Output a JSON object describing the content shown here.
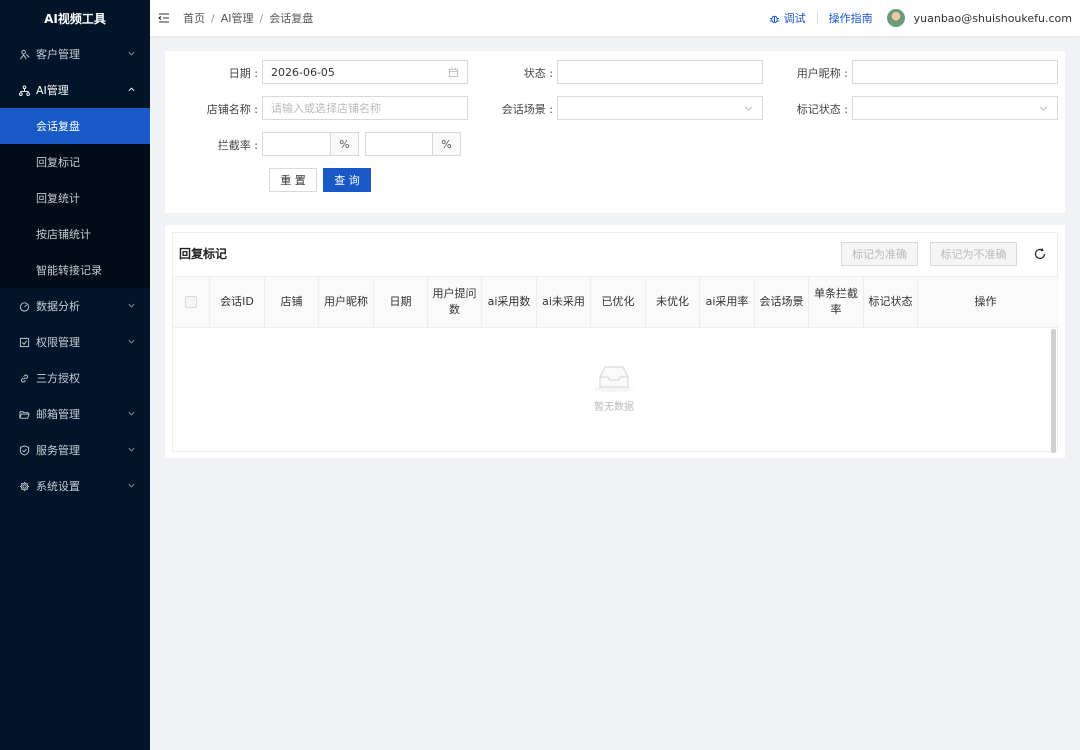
{
  "app": {
    "title": "AI视频工具"
  },
  "sidebar": {
    "items": [
      {
        "label": "客户管理"
      },
      {
        "label": "AI管理"
      },
      {
        "label": "数据分析"
      },
      {
        "label": "权限管理"
      },
      {
        "label": "三方授权"
      },
      {
        "label": "邮箱管理"
      },
      {
        "label": "服务管理"
      },
      {
        "label": "系统设置"
      }
    ],
    "ai_submenu": [
      {
        "label": "会话复盘"
      },
      {
        "label": "回复标记"
      },
      {
        "label": "回复统计"
      },
      {
        "label": "按店铺统计"
      },
      {
        "label": "智能转接记录"
      }
    ]
  },
  "breadcrumb": {
    "home": "首页",
    "section": "AI管理",
    "current": "会话复盘"
  },
  "topbar": {
    "debug": "调试",
    "guide": "操作指南",
    "user": "yuanbao@shuishoukefu.com"
  },
  "filter": {
    "date_label": "日期 :",
    "date_value": "2026-06-05",
    "status_label": "状态 :",
    "nickname_label": "用户昵称 :",
    "shop_label": "店铺名称 :",
    "shop_placeholder": "请输入或选择店铺名称",
    "scene_label": "会话场景 :",
    "mark_status_label": "标记状态 :",
    "intercept_label": "拦截率 :",
    "percent": "%",
    "reset": "重 置",
    "query": "查 询"
  },
  "table": {
    "title": "回复标记",
    "mark_accurate": "标记为准确",
    "mark_inaccurate": "标记为不准确",
    "headers": [
      "会话ID",
      "店铺",
      "用户昵称",
      "日期",
      "用户提问数",
      "ai采用数",
      "ai未采用",
      "已优化",
      "未优化",
      "ai采用率",
      "会话场景",
      "单条拦截率",
      "标记状态",
      "操作"
    ],
    "empty_text": "暂无数据"
  },
  "colors": {
    "primary": "#1659c7",
    "sidebar": "#001529",
    "background": "#f0f2f5"
  }
}
